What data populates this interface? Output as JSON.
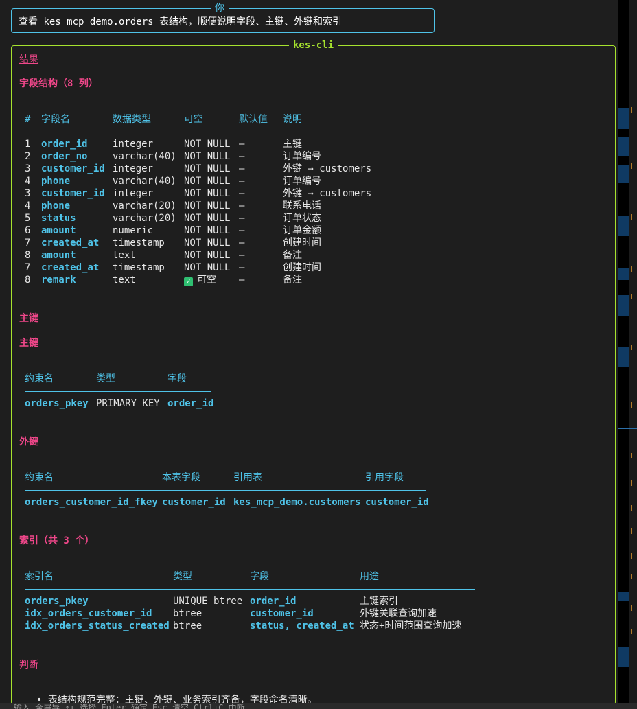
{
  "user_prompt": {
    "legend": "你",
    "text": "查看 kes_mcp_demo.orders 表结构，顺便说明字段、主键、外键和索引"
  },
  "panel": {
    "legend": "kes-cli"
  },
  "result_heading": "结果",
  "fields_section": {
    "title": "字段结构（8 列）",
    "headers": [
      "#",
      "字段名",
      "数据类型",
      "可空",
      "默认值",
      "说明"
    ],
    "rows": [
      {
        "n": "1",
        "name": "order_id",
        "type": "integer",
        "null": "NOT NULL",
        "def": "—",
        "desc": "主键"
      },
      {
        "n": "2",
        "name": "order_no",
        "type": "varchar(40)",
        "null": "NOT NULL",
        "def": "—",
        "desc": "订单编号"
      },
      {
        "n": "3",
        "name": "customer_id",
        "type": "integer",
        "null": "NOT NULL",
        "def": "—",
        "desc": "外键 → customers"
      },
      {
        "n": "4",
        "name": "phone",
        "type": "varchar(40)",
        "null": "NOT NULL",
        "def": "—",
        "desc": "订单编号"
      },
      {
        "n": "3",
        "name": "customer_id",
        "type": "integer",
        "null": "NOT NULL",
        "def": "—",
        "desc": "外键 → customers"
      },
      {
        "n": "4",
        "name": "phone",
        "type": "varchar(20)",
        "null": "NOT NULL",
        "def": "—",
        "desc": "联系电话"
      },
      {
        "n": "5",
        "name": "status",
        "type": "varchar(20)",
        "null": "NOT NULL",
        "def": "—",
        "desc": "订单状态"
      },
      {
        "n": "6",
        "name": "amount",
        "type": "numeric",
        "null": "NOT NULL",
        "def": "—",
        "desc": "订单金额"
      },
      {
        "n": "7",
        "name": "created_at",
        "type": "timestamp",
        "null": "NOT NULL",
        "def": "—",
        "desc": "创建时间"
      },
      {
        "n": "8",
        "name": "amount",
        "type": "text",
        "null": "NOT NULL",
        "def": "—",
        "desc": "备注"
      },
      {
        "n": "7",
        "name": "created_at",
        "type": "timestamp",
        "null": "NOT NULL",
        "def": "—",
        "desc": "创建时间"
      },
      {
        "n": "8",
        "name": "remark",
        "type": "text",
        "null": "✓ 可空",
        "def": "—",
        "desc": "备注"
      }
    ]
  },
  "pk_section": {
    "title_1": "主键",
    "title_2": "主键",
    "headers": [
      "约束名",
      "类型",
      "字段"
    ],
    "row": {
      "name": "orders_pkey",
      "type": "PRIMARY KEY",
      "field": "order_id"
    }
  },
  "fk_section": {
    "title": "外键",
    "headers": [
      "约束名",
      "本表字段",
      "引用表",
      "引用字段"
    ],
    "row": {
      "name": "orders_customer_id_fkey",
      "field": "customer_id",
      "ref_table": "kes_mcp_demo.customers",
      "ref_field": "customer_id"
    }
  },
  "idx_section": {
    "title": "索引（共 3 个）",
    "headers": [
      "索引名",
      "类型",
      "字段",
      "用途"
    ],
    "rows": [
      {
        "name": "orders_pkey",
        "type": "UNIQUE btree",
        "field": "order_id",
        "use": "主键索引"
      },
      {
        "name": "idx_orders_customer_id",
        "type": "btree",
        "field": "customer_id",
        "use": "外键关联查询加速"
      },
      {
        "name": "idx_orders_status_created",
        "type": "btree",
        "field": "status, created_at",
        "use": "状态+时间范围查询加速"
      }
    ]
  },
  "judgement": {
    "title": "判断",
    "bullet": "表结构规范完整：主键、外键、业务索引齐备，字段命名清晰。"
  },
  "status_bar": {
    "text": "输入 全屏导 ↑↓ 选择 Enter 确定 Esc 清空 Ctrl+C 中断"
  },
  "colors": {
    "background": "#1e1e1e",
    "prompt_border": "#4fc3e8",
    "panel_border": "#a6e22e",
    "heading": "#f0478a",
    "accent": "#4fc3e8",
    "scroll_marker": "#0f3a63"
  }
}
